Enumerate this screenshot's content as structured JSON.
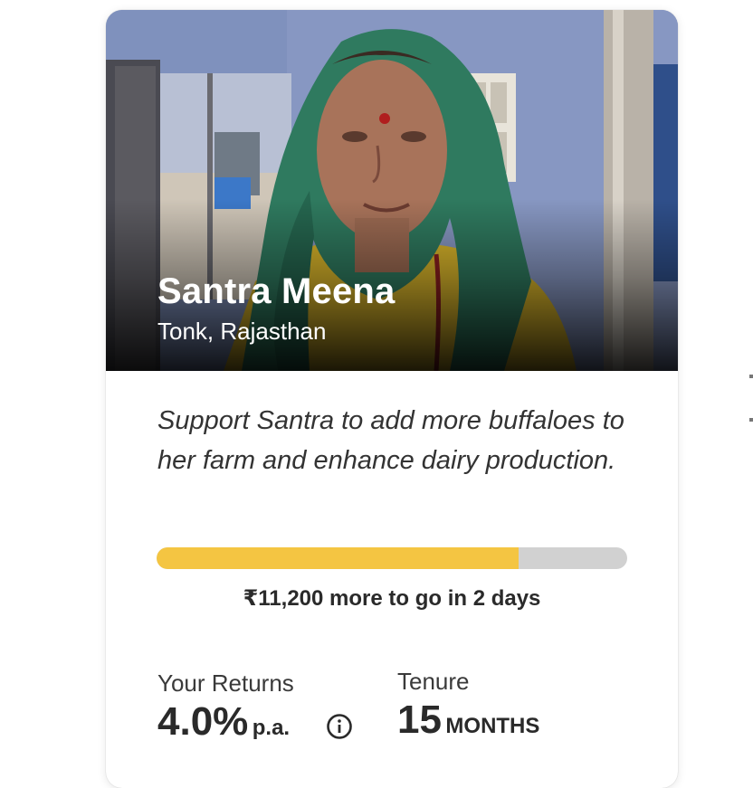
{
  "campaign": {
    "name": "Santra Meena",
    "location": "Tonk, Rajasthan",
    "description": "Support Santra to add more buffaloes to her farm and enhance dairy production.",
    "progress_fraction": 0.77,
    "remaining_text": "₹11,200 more to go in 2 days"
  },
  "stats": {
    "returns_label": "Your Returns",
    "returns_value": "4.0%",
    "returns_unit": "p.a.",
    "tenure_label": "Tenure",
    "tenure_value": "15",
    "tenure_unit": "MONTHS"
  },
  "icons": {
    "info": "info-circle-icon"
  },
  "colors": {
    "progress_fill": "#f4c542",
    "progress_track": "#d1d1d1",
    "text_dark": "#2a2a2a"
  }
}
